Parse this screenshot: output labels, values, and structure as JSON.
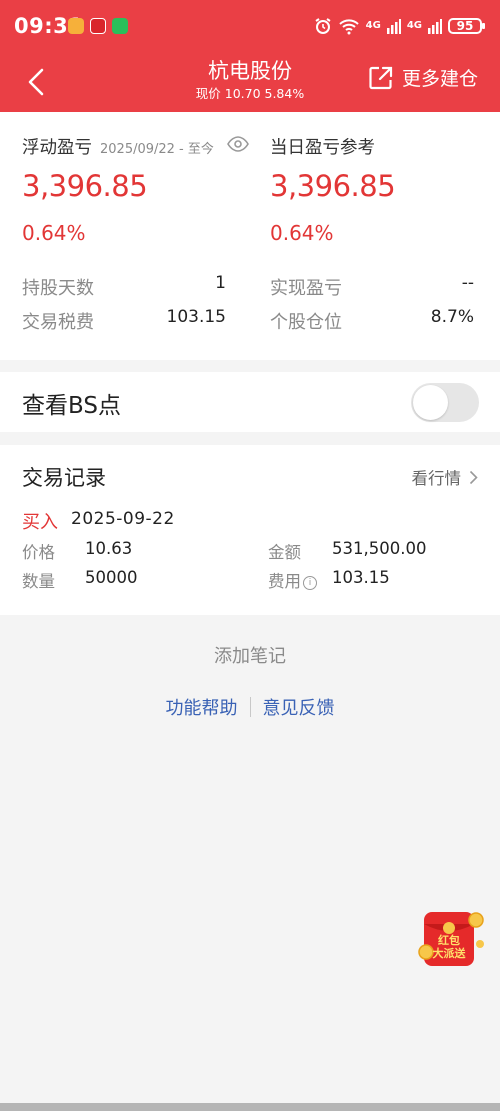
{
  "status_bar": {
    "time": "09:31",
    "net_1": "4G",
    "net_2": "4G",
    "battery": "95"
  },
  "header": {
    "title": "杭电股份",
    "subtitle": "现价 10.70 5.84%",
    "more_label": "更多建仓",
    "bg_color": "#ea3f45"
  },
  "pl": {
    "floating_label": "浮动盈亏",
    "date_range": "2025/09/22 - 至今",
    "floating_value": "3,396.85",
    "floating_pct": "0.64%",
    "daily_label": "当日盈亏参考",
    "daily_value": "3,396.85",
    "daily_pct": "0.64%",
    "rows": [
      {
        "k1": "持股天数",
        "v1": "1",
        "k2": "实现盈亏",
        "v2": "--"
      },
      {
        "k1": "交易税费",
        "v1": "103.15",
        "k2": "个股仓位",
        "v2": "8.7%"
      }
    ],
    "up_color": "#e23636"
  },
  "bs": {
    "label": "查看BS点",
    "enabled": false
  },
  "trades": {
    "title": "交易记录",
    "market_link": "看行情",
    "records": [
      {
        "side": "买入",
        "date": "2025-09-22",
        "price_label": "价格",
        "price": "10.63",
        "amount_label": "金额",
        "amount": "531,500.00",
        "qty_label": "数量",
        "qty": "50000",
        "fee_label": "费用",
        "fee": "103.15"
      }
    ]
  },
  "footer": {
    "add_note": "添加笔记",
    "help": "功能帮助",
    "feedback": "意见反馈",
    "link_color": "#3a62b5"
  },
  "promo": {
    "line1": "红包",
    "line2": "大派送"
  }
}
